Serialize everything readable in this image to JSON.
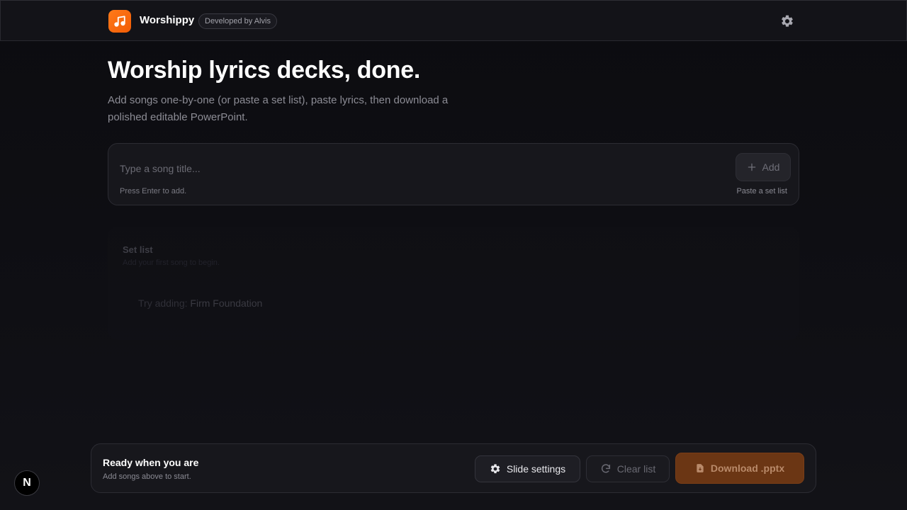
{
  "header": {
    "app_title": "Worshippy",
    "badge": "Developed by Alvis",
    "logo_icon": "music-note-icon",
    "settings_icon": "gear-icon",
    "accent_color": "#f56a0c"
  },
  "hero": {
    "title": "Worship lyrics decks, done.",
    "subtitle": "Add songs one-by-one (or paste a set list), paste lyrics, then download a polished editable PowerPoint."
  },
  "add_song": {
    "placeholder": "Type a song title...",
    "hint": "Press Enter to add.",
    "add_label": "Add",
    "paste_link": "Paste a set list"
  },
  "set_list": {
    "title": "Set list",
    "subtitle": "Add your first song to begin.",
    "try_prefix": "Try adding:",
    "try_song": "Firm Foundation"
  },
  "footer_bar": {
    "status_title": "Ready when you are",
    "status_sub": "Add songs above to start.",
    "slide_settings_label": "Slide settings",
    "clear_label": "Clear list",
    "download_label": "Download .pptx",
    "download_color": "#6b3614"
  },
  "dev_badge": {
    "label": "N"
  }
}
